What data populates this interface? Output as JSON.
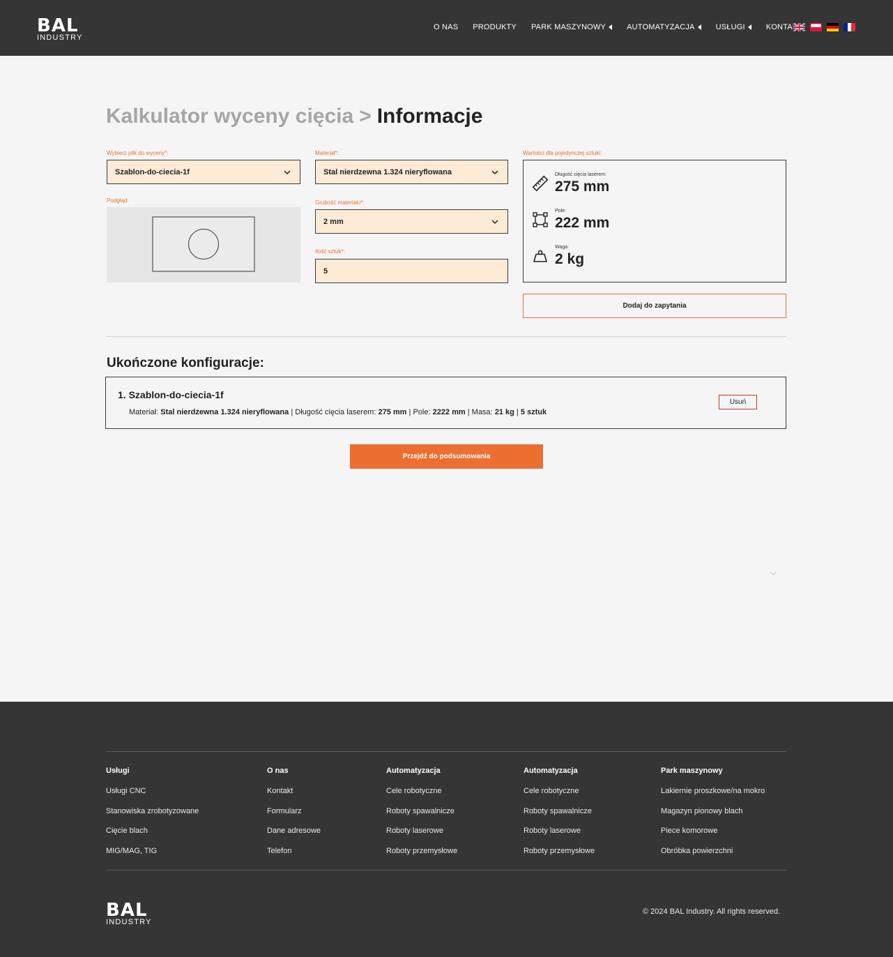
{
  "header": {
    "logo": {
      "line1": "BAL",
      "line2": "INDUSTRY"
    },
    "nav": [
      {
        "label": "O NAS",
        "has_caret": false
      },
      {
        "label": "PRODUKTY",
        "has_caret": false
      },
      {
        "label": "PARK MASZYNOWY",
        "has_caret": true
      },
      {
        "label": "AUTOMATYZACJA",
        "has_caret": true
      },
      {
        "label": "USŁUGI",
        "has_caret": true
      },
      {
        "label": "KONTAKT",
        "has_caret": false
      }
    ],
    "flags": [
      "uk-flag-icon",
      "poland-flag-icon",
      "germany-flag-icon",
      "france-flag-icon"
    ]
  },
  "page": {
    "breadcrumb": "Kalkulator wyceny cięcia",
    "breadcrumb_sep": ">",
    "current": "Informacje"
  },
  "form": {
    "file_label": "Wybierz plik do wyceny*:",
    "file_value": "Szablon-do-ciecia-1f",
    "preview_label": "Podgląd:",
    "material_label": "Materiał*:",
    "material_value": "Stal nierdzewna 1.324 nieryflowana",
    "thickness_label": "Grubość materiału*:",
    "thickness_value": "2 mm",
    "qty_label": "Ilość sztuk*:",
    "qty_value": "5"
  },
  "values": {
    "heading": "Wartości dla pojedynczej sztuki:",
    "length_label": "Długość cięcia laserem:",
    "length_value": "275 mm",
    "area_label": "Pole:",
    "area_value": "222 mm",
    "weight_label": "Waga:",
    "weight_value": "2 kg"
  },
  "add_button": "Dodaj do zapytania",
  "completed": {
    "title": "Ukończone konfiguracje:",
    "items": [
      {
        "name": "1.  Szablon-do-ciecia-1f",
        "material_label": "Materiał:",
        "material": "Stal nierdzewna 1.324 nieryflowana",
        "length_label": "Długość cięcia laserem:",
        "length": "275 mm",
        "area_label": "Pole:",
        "area": "2222 mm",
        "mass_label": "Masa:",
        "mass": "21 kg",
        "count": "5 sztuk",
        "remove": "Usuń"
      }
    ]
  },
  "summary_button": "Przejdź do podsumowania",
  "footer": {
    "columns": [
      {
        "title": "Usługi",
        "links": [
          "Usługi CNC",
          "Stanowiska zrobotyzowane",
          "Cięcie blach",
          "MIG/MAG, TIG"
        ]
      },
      {
        "title": "O nas",
        "links": [
          "Kontakt",
          "Formularz",
          "Dane adresowe",
          "Telefon"
        ]
      },
      {
        "title": "Automatyzacja",
        "links": [
          "Cele robotyczne",
          "Roboty spawalnicze",
          "Roboty laserowe",
          "Roboty przemysłowe"
        ]
      },
      {
        "title": "Automatyzacja",
        "links": [
          "Cele robotyczne",
          "Roboty spawalnicze",
          "Roboty laserowe",
          "Roboty przemysłowe"
        ]
      },
      {
        "title": "Park maszynowy",
        "links": [
          "Lakiernie proszkowe/na mokro",
          "Magazyn pionowy blach",
          "Piece komorowe",
          "Obróbka powierzchni"
        ]
      }
    ],
    "logo": {
      "line1": "BAL",
      "line2": "INDUSTRY"
    },
    "copyright": "© 2024 BAL Industry. All rights reserved."
  },
  "colors": {
    "accent": "#ec6f31",
    "input_bg": "#fdebd6",
    "dark": "#353535",
    "page_bg": "#f5f5f5"
  }
}
